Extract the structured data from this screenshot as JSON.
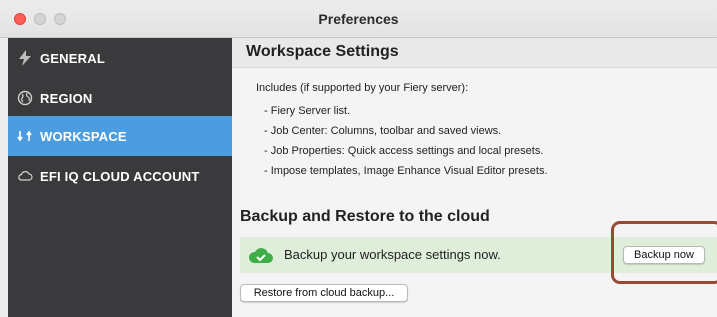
{
  "window": {
    "title": "Preferences"
  },
  "sidebar": {
    "items": [
      {
        "label": "GENERAL",
        "icon": "lightning-icon"
      },
      {
        "label": "REGION",
        "icon": "globe-icon"
      },
      {
        "label": "WORKSPACE",
        "icon": "sync-icon",
        "active": true
      },
      {
        "label": "EFI IQ CLOUD ACCOUNT",
        "icon": "cloud-icon"
      }
    ]
  },
  "main": {
    "title": "Workspace Settings",
    "intro": "Includes (if supported by your Fiery server):",
    "bullets": [
      "- Fiery Server list.",
      "- Job Center: Columns, toolbar and saved views.",
      "- Job Properties: Quick access settings and local presets.",
      "- Impose templates, Image Enhance Visual Editor presets."
    ],
    "cloud_section_title": "Backup and Restore to the cloud",
    "backup_message": "Backup your workspace settings now.",
    "backup_button": "Backup now",
    "restore_button": "Restore from cloud backup..."
  },
  "colors": {
    "sidebar_bg": "#3a3a3c",
    "sidebar_active": "#4b9de0",
    "backup_bar_bg": "#dfeeda",
    "cloud_green": "#3fae49",
    "highlight_border": "#9a4a33"
  }
}
